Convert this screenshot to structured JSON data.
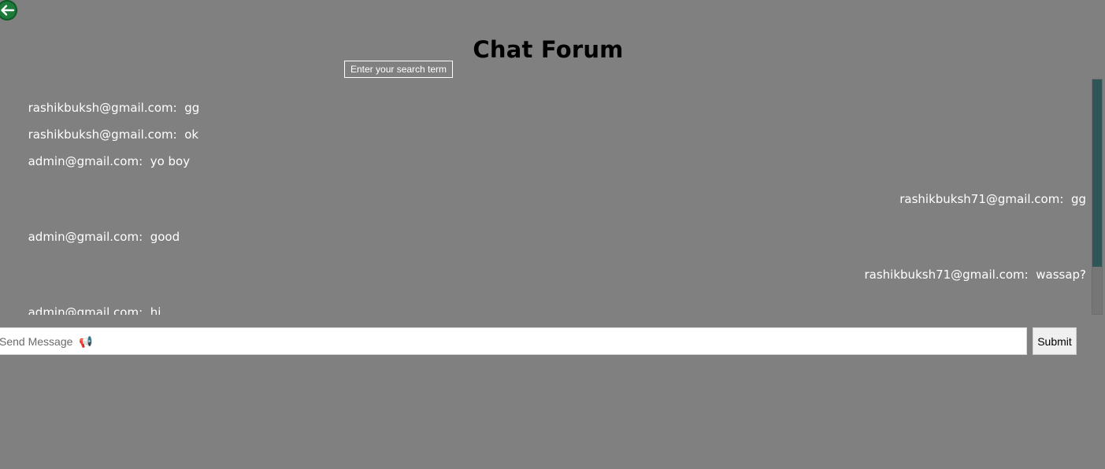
{
  "app": {
    "title": "Chat Forum"
  },
  "back_button": {
    "icon": "arrow-left-icon",
    "color": "#1d7a3a"
  },
  "search_tooltip": {
    "text": "Enter your search term"
  },
  "messages": [
    {
      "sender": "rashikbuksh@gmail.com:",
      "text": "gg",
      "align": "left"
    },
    {
      "sender": "rashikbuksh@gmail.com:",
      "text": "ok",
      "align": "left"
    },
    {
      "sender": "admin@gmail.com:",
      "text": "yo boy",
      "align": "left"
    },
    {
      "sender": "rashikbuksh71@gmail.com:",
      "text": "gg",
      "align": "right"
    },
    {
      "sender": "admin@gmail.com:",
      "text": "good",
      "align": "left"
    },
    {
      "sender": "rashikbuksh71@gmail.com:",
      "text": "wassap?",
      "align": "right"
    },
    {
      "sender": "admin@gmail.com:",
      "text": "hi",
      "align": "left"
    }
  ],
  "composer": {
    "placeholder": "Send Message  📢",
    "value": "",
    "submit_label": "Submit"
  },
  "colors": {
    "background": "#808080",
    "scroll_thumb": "#2f5557",
    "text": "#ffffff"
  }
}
